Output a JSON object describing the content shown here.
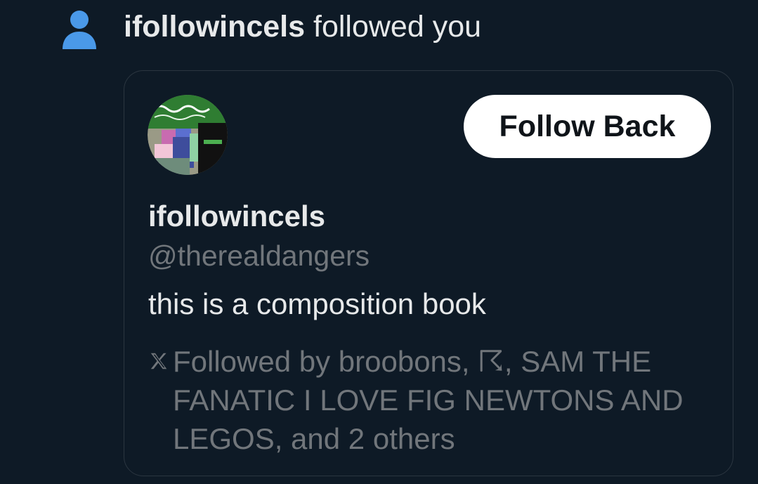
{
  "notification": {
    "icon": "person-icon",
    "username": "ifollowincels",
    "action": "followed you",
    "accent_color": "#4a99e9"
  },
  "card": {
    "follow_back_label": "Follow Back",
    "display_name": "ifollowincels",
    "handle": "@therealdangers",
    "bio": "this is a composition book",
    "followed_by_icon": "x-logo-icon",
    "followed_by_text": "Followed by broobons, ☈, SAM THE FANATIC I LOVE FIG NEWTONS AND LEGOS, and 2 others"
  },
  "colors": {
    "background": "#0e1a26",
    "text_primary": "#e7e9ea",
    "text_secondary": "#71767b",
    "border": "#2b3640",
    "button_bg": "#ffffff"
  }
}
